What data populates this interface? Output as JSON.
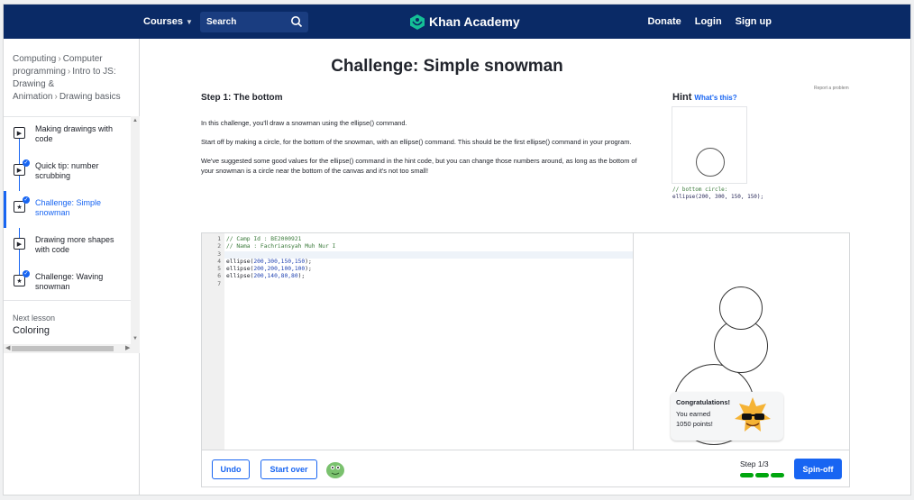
{
  "nav": {
    "courses": "Courses",
    "search_placeholder": "Search",
    "logo_text": "Khan Academy",
    "donate": "Donate",
    "login": "Login",
    "signup": "Sign up",
    "brand_color": "#0a2a66"
  },
  "sidebar": {
    "breadcrumb": [
      "Computing",
      "Computer programming",
      "Intro to JS: Drawing & Animation",
      "Drawing basics"
    ],
    "items": [
      {
        "label": "Making drawings with code",
        "icon": "play-icon",
        "done": false
      },
      {
        "label": "Quick tip: number scrubbing",
        "icon": "play-icon",
        "done": true
      },
      {
        "label": "Challenge: Simple snowman",
        "icon": "star-icon",
        "done": true,
        "active": true
      },
      {
        "label": "Drawing more shapes with code",
        "icon": "play-icon",
        "done": false
      },
      {
        "label": "Challenge: Waving snowman",
        "icon": "star-icon",
        "done": true
      }
    ],
    "next_label": "Next lesson",
    "next_title": "Coloring"
  },
  "main": {
    "title": "Challenge: Simple snowman",
    "step_title": "Step 1: The bottom",
    "report": "Report a problem",
    "paragraphs": [
      "In this challenge, you'll draw a snowman using the ellipse() command.",
      "Start off by making a circle, for the bottom of the snowman, with an ellipse() command. This should be the first ellipse() command in your program.",
      "We've suggested some good values for the ellipse() command in the hint code, but you can change those numbers around, as long as the bottom of your snowman is a circle near the bottom of the canvas and it's not too small!"
    ],
    "hint_title": "Hint",
    "hint_whats": "What's this?",
    "hint_comment": "// bottom circle:",
    "hint_code": "ellipse(200, 300, 150, 150);"
  },
  "editor": {
    "line_numbers": [
      "1",
      "2",
      "3",
      "4",
      "5",
      "6",
      "7"
    ],
    "lines": [
      {
        "type": "comment",
        "text": "// Camp Id : BE2000921"
      },
      {
        "type": "comment",
        "text": "// Nama : Fachriansyah Muh Nur I"
      },
      {
        "type": "blank",
        "text": ""
      },
      {
        "type": "call",
        "fn": "ellipse(",
        "args": "200,300,150,150",
        "end": ");"
      },
      {
        "type": "call",
        "fn": "ellipse(",
        "args": "200,200,100,100",
        "end": ");"
      },
      {
        "type": "call",
        "fn": "ellipse(",
        "args": "200,140,80,80",
        "end": ");"
      },
      {
        "type": "blank",
        "text": ""
      }
    ],
    "congrats_title": "Congratulations!",
    "congrats_line1": "You earned",
    "congrats_line2": "1050 points!",
    "undo": "Undo",
    "start_over": "Start over",
    "step_label": "Step 1/3",
    "steps_total": 3,
    "steps_complete": 3,
    "spin_off": "Spin-off",
    "accent": "#1865f2",
    "progress_color": "#00a60e"
  }
}
